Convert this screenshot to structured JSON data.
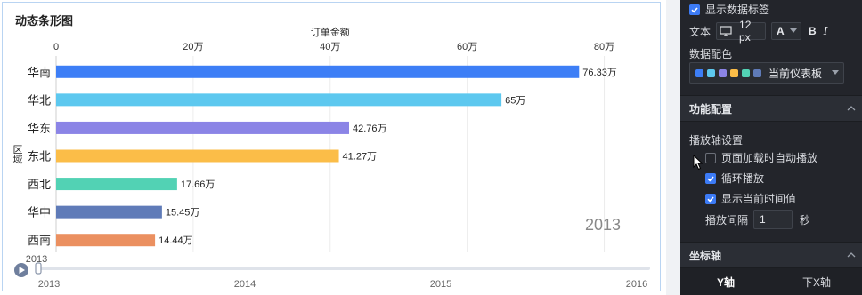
{
  "chart": {
    "title": "动态条形图",
    "x_axis_title": "订单金额",
    "y_axis_title": "区域",
    "current_year": "2013",
    "timeline_current": "2013",
    "timeline_labels": [
      "2013",
      "2014",
      "2015",
      "2016"
    ]
  },
  "chart_data": {
    "type": "bar",
    "orientation": "horizontal",
    "title": "动态条形图",
    "xlabel": "订单金额",
    "ylabel": "区域",
    "xlim": [
      0,
      85
    ],
    "x_unit": "万",
    "x_ticks": [
      "0",
      "20万",
      "40万",
      "60万",
      "80万"
    ],
    "x_tick_values": [
      0,
      20,
      40,
      60,
      80
    ],
    "categories": [
      "华南",
      "华北",
      "华东",
      "东北",
      "西北",
      "华中",
      "西南"
    ],
    "values": [
      76.33,
      65,
      42.76,
      41.27,
      17.66,
      15.45,
      14.44
    ],
    "value_labels": [
      "76.33万",
      "65万",
      "42.76万",
      "41.27万",
      "17.66万",
      "15.45万",
      "14.44万"
    ],
    "colors": [
      "#3d7ef6",
      "#5dc8ef",
      "#8b84e6",
      "#fbbd48",
      "#52d2b4",
      "#5f7bb8",
      "#eb9060"
    ],
    "grid": true,
    "legend": "none",
    "timeline": {
      "labels": [
        "2013",
        "2014",
        "2015",
        "2016"
      ],
      "current": "2013"
    }
  },
  "settings": {
    "show_data_labels": "显示数据标签",
    "text_label": "文本",
    "font_size": "12 px",
    "font_letter": "A",
    "bold": "B",
    "italic": "I",
    "data_color_label": "数据配色",
    "palette_name": "当前仪表板",
    "palette_colors": [
      "#3d7ef6",
      "#5dc8ef",
      "#8b84e6",
      "#fbbd48",
      "#52d2b4",
      "#5f7bb8"
    ],
    "feature_section": "功能配置",
    "playback_axis_settings": "播放轴设置",
    "autoplay_on_load": "页面加载时自动播放",
    "loop_play": "循环播放",
    "show_current_time": "显示当前时间值",
    "interval_label": "播放间隔",
    "interval_value": "1",
    "interval_unit": "秒",
    "axis_section": "坐标轴",
    "tab_y": "Y轴",
    "tab_x": "下X轴"
  }
}
